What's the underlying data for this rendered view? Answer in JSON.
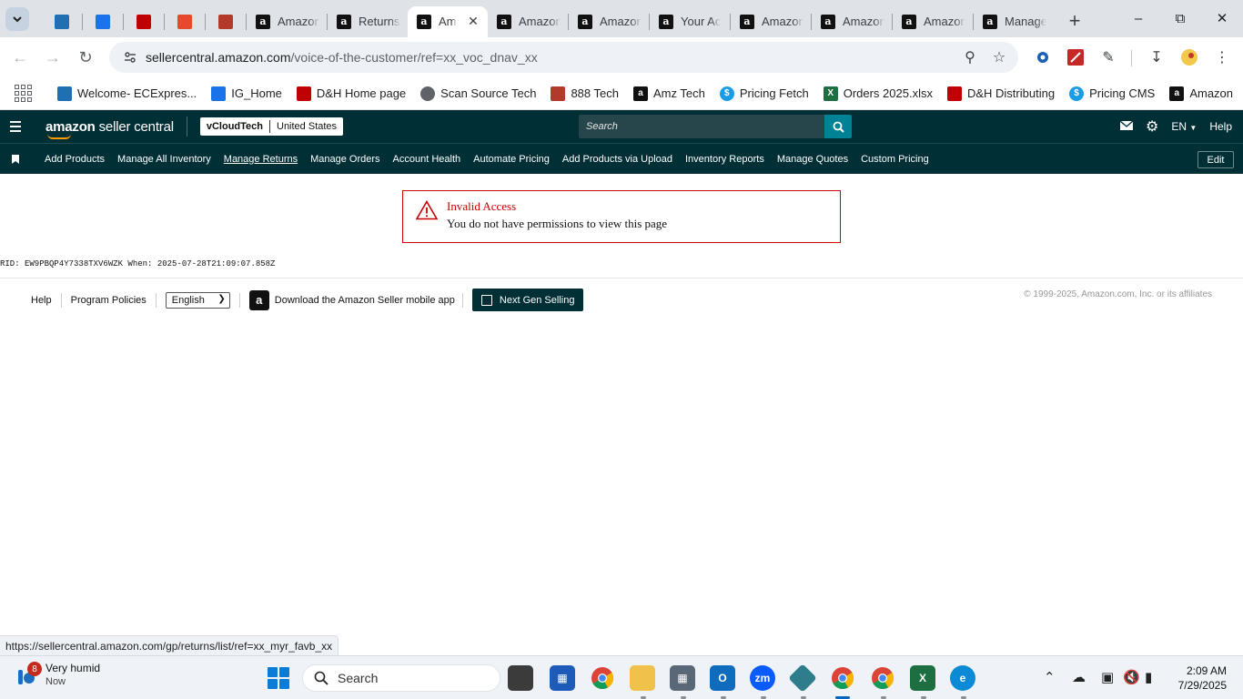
{
  "browser": {
    "tabs": [
      {
        "label": "",
        "icon": "ec-icon",
        "color": "#1f6fb2"
      },
      {
        "label": "",
        "icon": "ig-icon",
        "color": "#1a73e8"
      },
      {
        "label": "",
        "icon": "dh-icon",
        "color": "#c00000"
      },
      {
        "label": "",
        "icon": "scansource-icon",
        "color": "#e8492c"
      },
      {
        "label": "",
        "icon": "888-icon",
        "color": "#b13a2a"
      },
      {
        "label": "Amazon",
        "icon": "amazon-icon"
      },
      {
        "label": "Returns",
        "icon": "amazon-icon"
      },
      {
        "label": "Am",
        "icon": "amazon-icon",
        "active": true
      },
      {
        "label": "Amazon",
        "icon": "amazon-icon"
      },
      {
        "label": "Amazon",
        "icon": "amazon-icon"
      },
      {
        "label": "Your Ac",
        "icon": "amazon-icon"
      },
      {
        "label": "Amazon",
        "icon": "amazon-icon"
      },
      {
        "label": "Amazon",
        "icon": "amazon-smile-icon"
      },
      {
        "label": "Amazon",
        "icon": "amazon-icon"
      },
      {
        "label": "Manage",
        "icon": "amazon-icon"
      }
    ],
    "url_host": "sellercentral.amazon.com",
    "url_path": "/voice-of-the-customer/ref=xx_voc_dnav_xx",
    "bookmarks": [
      {
        "label": "Welcome- ECExpres...",
        "icon": "ec-icon",
        "color": "#1f6fb2"
      },
      {
        "label": "IG_Home",
        "icon": "ig-icon",
        "color": "#1a73e8"
      },
      {
        "label": "D&H Home page",
        "icon": "dh-icon",
        "color": "#c00000"
      },
      {
        "label": "Scan Source Tech",
        "icon": "globe-icon",
        "color": "#5f6368"
      },
      {
        "label": "888 Tech",
        "icon": "888-icon",
        "color": "#b13a2a"
      },
      {
        "label": "Amz Tech",
        "icon": "amazon-icon",
        "color": "#111111"
      },
      {
        "label": "Pricing Fetch",
        "icon": "dollar-icon",
        "color": "#1a9be6"
      },
      {
        "label": "Orders 2025.xlsx",
        "icon": "excel-icon",
        "color": "#1d6f42"
      },
      {
        "label": "D&H Distributing",
        "icon": "dh-icon",
        "color": "#c00000"
      },
      {
        "label": "Pricing CMS",
        "icon": "dollar-icon",
        "color": "#1a9be6"
      },
      {
        "label": "Amazon",
        "icon": "amazon-icon",
        "color": "#111111"
      }
    ],
    "status_url": "https://sellercentral.amazon.com/gp/returns/list/ref=xx_myr_favb_xx"
  },
  "seller_central": {
    "logo_text_bold": "amazon",
    "logo_text": " seller central",
    "account_name": "vCloudTech",
    "marketplace": "United States",
    "search_placeholder": "Search",
    "language": "EN",
    "help": "Help",
    "nav_links": [
      {
        "label": "Add Products"
      },
      {
        "label": "Manage All Inventory"
      },
      {
        "label": "Manage Returns",
        "active": true
      },
      {
        "label": "Manage Orders"
      },
      {
        "label": "Account Health"
      },
      {
        "label": "Automate Pricing"
      },
      {
        "label": "Add Products via Upload"
      },
      {
        "label": "Inventory Reports"
      },
      {
        "label": "Manage Quotes"
      },
      {
        "label": "Custom Pricing"
      }
    ],
    "edit_label": "Edit",
    "brand_color": "#002f36",
    "accent_color": "#008296"
  },
  "alert": {
    "title": "Invalid Access",
    "message": "You do not have permissions to view this page",
    "color": "#c40000"
  },
  "rid_line": "RID: EW9PBQP4Y7338TXV6WZK When: 2025-07-28T21:09:07.858Z",
  "footer": {
    "help": "Help",
    "program_policies": "Program Policies",
    "language_selected": "English",
    "mobile_app": "Download the Amazon Seller mobile app",
    "next_gen": "Next Gen Selling",
    "copyright": "© 1999-2025, Amazon.com, Inc. or its affiliates"
  },
  "taskbar": {
    "weather_badge": "8",
    "weather_title": "Very humid",
    "weather_sub": "Now",
    "search_placeholder": "Search",
    "time": "2:09 AM",
    "date": "7/29/2025"
  }
}
